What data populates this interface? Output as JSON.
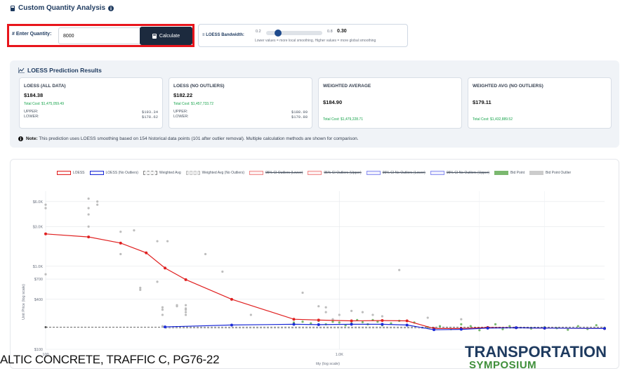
{
  "header": {
    "title": "Custom Quantity Analysis",
    "info_icon": "info-circle-icon",
    "title_icon": "calculator-icon"
  },
  "quantity": {
    "label": "# Enter Quantity:",
    "value": "8000",
    "button_label": "Calculate",
    "button_icon": "calculator-icon",
    "highlight_color": "#e8151c"
  },
  "bandwidth": {
    "label": "LOESS Bandwidth:",
    "min_label": "0.2",
    "max_label": "0.8",
    "value": "0.30",
    "hint": "Lower values = more local smoothing, Higher values = more global smoothing"
  },
  "results": {
    "title": "LOESS Prediction Results",
    "cards": [
      {
        "title": "LOESS (ALL DATA)",
        "price": "$184.38",
        "total": "Total Cost: $1,475,059.49",
        "upper_label": "UPPER:",
        "upper": "$193.34",
        "lower_label": "LOWER:",
        "lower": "$178.62"
      },
      {
        "title": "LOESS (NO OUTLIERS)",
        "price": "$182.22",
        "total": "Total Cost: $1,457,733.72",
        "upper_label": "UPPER:",
        "upper": "$188.90",
        "lower_label": "LOWER:",
        "lower": "$170.88"
      },
      {
        "title": "WEIGHTED AVERAGE",
        "price": "$184.90",
        "total": "Total Cost: $1,479,228.71"
      },
      {
        "title": "WEIGHTED AVG (NO OUTLIERS)",
        "price": "$179.11",
        "total": "Total Cost: $1,432,889.52"
      }
    ],
    "note_label": "Note:",
    "note_text": "This prediction uses LOESS smoothing based on 154 historical data points (101 after outlier removal). Multiple calculation methods are shown for comparison."
  },
  "legend": [
    {
      "label": "LOESS",
      "color": "#e02020",
      "fill": "rgba(224,32,32,0.08)",
      "struck": false
    },
    {
      "label": "LOESS (No Outliers)",
      "color": "#1a2ad6",
      "fill": "rgba(26,42,214,0.08)",
      "struck": false
    },
    {
      "label": "Weighted Avg",
      "color": "#888888",
      "fill": "#f3f3f3",
      "struck": false,
      "dashed": true
    },
    {
      "label": "Weighted Avg (No Outliers)",
      "color": "#bbbbbb",
      "fill": "#e9e9e9",
      "struck": false,
      "dashed": true
    },
    {
      "label": "95% CI Outliers (Lower)",
      "color": "#f08a8a",
      "fill": "rgba(240,138,138,0.15)",
      "struck": true
    },
    {
      "label": "95% CI Outliers (Upper)",
      "color": "#f08a8a",
      "fill": "rgba(240,138,138,0.15)",
      "struck": true
    },
    {
      "label": "95% CI No Outliers (Lower)",
      "color": "#8a8ff0",
      "fill": "rgba(138,143,240,0.15)",
      "struck": true
    },
    {
      "label": "95% CI No Outliers (Upper)",
      "color": "#8a8ff0",
      "fill": "rgba(138,143,240,0.15)",
      "struck": true
    },
    {
      "label": "Bid Point",
      "color": "#7bb86f",
      "fill": "#7bb86f",
      "struck": false
    },
    {
      "label": "Bid Point Outlier",
      "color": "#cccccc",
      "fill": "#cccccc",
      "struck": false
    }
  ],
  "chart_data": {
    "type": "scatter",
    "x_scale": "log",
    "y_scale": "log",
    "xlabel": "tity (log scale)",
    "ylabel": "Unit Price (log scale)",
    "x_ticks": [
      {
        "value": 100,
        "label": "100"
      },
      {
        "value": 1000,
        "label": "1.0K"
      }
    ],
    "y_ticks": [
      {
        "value": 100,
        "label": "$100"
      },
      {
        "value": 400,
        "label": "$400"
      },
      {
        "value": 700,
        "label": "$700"
      },
      {
        "value": 1000,
        "label": "$1.0K"
      },
      {
        "value": 3000,
        "label": "$3.0K"
      },
      {
        "value": 6000,
        "label": "$6.0K"
      }
    ],
    "xlim": [
      100,
      8000
    ],
    "ylim": [
      100,
      8000
    ],
    "grid": true,
    "weighted_avg": 184.9,
    "weighted_avg_no_outliers": 179.11,
    "loess": [
      [
        100,
        2450
      ],
      [
        140,
        2250
      ],
      [
        180,
        1900
      ],
      [
        220,
        1450
      ],
      [
        255,
        950
      ],
      [
        300,
        690
      ],
      [
        430,
        400
      ],
      [
        700,
        230
      ],
      [
        850,
        225
      ],
      [
        1100,
        220
      ],
      [
        1400,
        222
      ],
      [
        1700,
        220
      ],
      [
        2100,
        178
      ],
      [
        2600,
        178
      ],
      [
        3200,
        183
      ],
      [
        4000,
        182
      ],
      [
        5000,
        180
      ],
      [
        8000,
        178
      ]
    ],
    "loess_no_outliers": [
      [
        255,
        186
      ],
      [
        430,
        196
      ],
      [
        700,
        200
      ],
      [
        850,
        198
      ],
      [
        1100,
        200
      ],
      [
        1400,
        200
      ],
      [
        1700,
        196
      ],
      [
        2100,
        172
      ],
      [
        2600,
        174
      ],
      [
        3200,
        180
      ],
      [
        4000,
        182
      ],
      [
        5000,
        180
      ],
      [
        8000,
        178
      ]
    ],
    "bid_points": [
      [
        700,
        210
      ],
      [
        750,
        215
      ],
      [
        800,
        205
      ],
      [
        850,
        220
      ],
      [
        900,
        200
      ],
      [
        950,
        215
      ],
      [
        1000,
        210
      ],
      [
        1050,
        195
      ],
      [
        1100,
        205
      ],
      [
        1150,
        225
      ],
      [
        1200,
        212
      ],
      [
        1250,
        200
      ],
      [
        1300,
        225
      ],
      [
        1350,
        215
      ],
      [
        1400,
        195
      ],
      [
        1500,
        205
      ],
      [
        1600,
        220
      ],
      [
        1800,
        210
      ],
      [
        2000,
        185
      ],
      [
        2200,
        190
      ],
      [
        2400,
        175
      ],
      [
        2600,
        200
      ],
      [
        2800,
        190
      ],
      [
        3000,
        170
      ],
      [
        3200,
        185
      ],
      [
        3400,
        200
      ],
      [
        3600,
        175
      ],
      [
        3800,
        190
      ],
      [
        4000,
        182
      ],
      [
        4500,
        178
      ],
      [
        5000,
        185
      ],
      [
        5500,
        180
      ],
      [
        6000,
        172
      ],
      [
        6500,
        190
      ],
      [
        7000,
        176
      ],
      [
        7500,
        195
      ],
      [
        8000,
        182
      ]
    ],
    "bid_point_outliers": [
      [
        100,
        5500
      ],
      [
        100,
        5000
      ],
      [
        100,
        800
      ],
      [
        140,
        6500
      ],
      [
        140,
        5000
      ],
      [
        140,
        4200
      ],
      [
        140,
        3000
      ],
      [
        150,
        6000
      ],
      [
        150,
        5500
      ],
      [
        180,
        2600
      ],
      [
        180,
        1400
      ],
      [
        200,
        2700
      ],
      [
        210,
        550
      ],
      [
        210,
        520
      ],
      [
        240,
        2000
      ],
      [
        240,
        650
      ],
      [
        250,
        190
      ],
      [
        250,
        320
      ],
      [
        250,
        300
      ],
      [
        250,
        260
      ],
      [
        260,
        2000
      ],
      [
        280,
        330
      ],
      [
        280,
        340
      ],
      [
        300,
        340
      ],
      [
        300,
        310
      ],
      [
        300,
        300
      ],
      [
        300,
        280
      ],
      [
        300,
        260
      ],
      [
        350,
        1400
      ],
      [
        400,
        860
      ],
      [
        500,
        260
      ],
      [
        750,
        480
      ],
      [
        850,
        330
      ],
      [
        900,
        320
      ],
      [
        900,
        280
      ],
      [
        950,
        230
      ],
      [
        1000,
        260
      ],
      [
        1100,
        290
      ],
      [
        1200,
        280
      ],
      [
        1300,
        260
      ],
      [
        1400,
        250
      ],
      [
        1600,
        900
      ],
      [
        2000,
        240
      ],
      [
        2600,
        230
      ]
    ]
  },
  "footer": {
    "text": "ALTIC CONCRETE, TRAFFIC C, PG76-22",
    "brand": "TRANSPORTATION",
    "brand_sub": "SYMPOSIUM"
  }
}
